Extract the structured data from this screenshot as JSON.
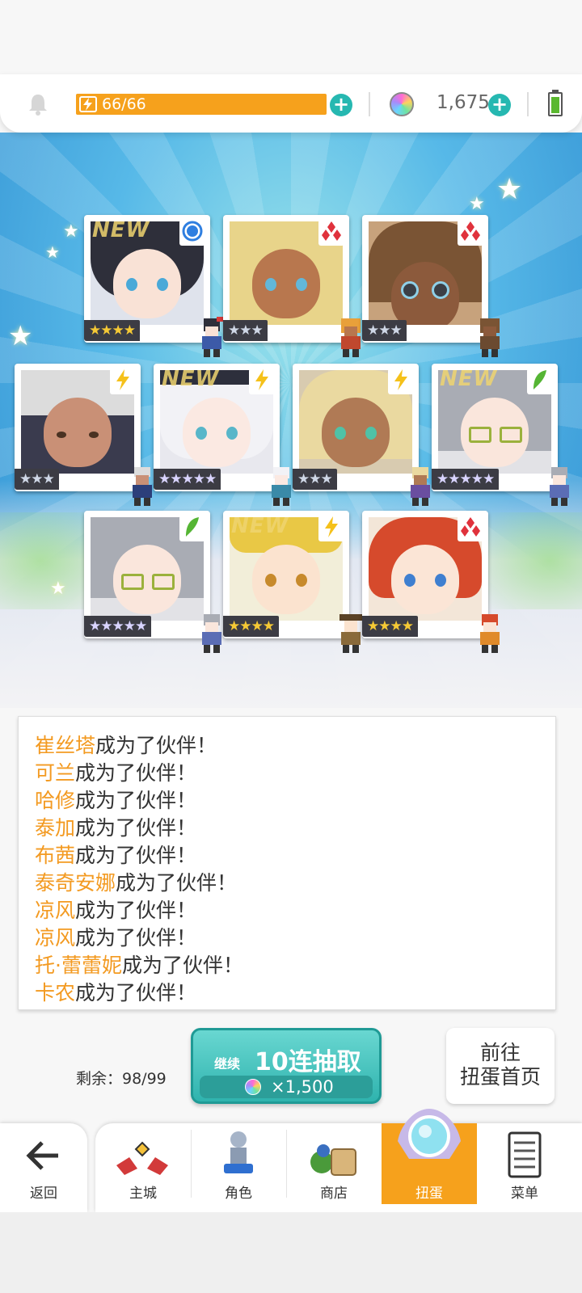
{
  "colors": {
    "accent_orange": "#f6a11c",
    "teal": "#2fb3ae",
    "name_orange": "#f39a21"
  },
  "topbar": {
    "bell_icon": "bell-icon",
    "stamina": "66/66",
    "gems": "1,675"
  },
  "results": {
    "new_label": "NEW",
    "cards": [
      {
        "stars": "★★★★",
        "attribute": "blue-circle",
        "is_new": true
      },
      {
        "stars": "★★★",
        "attribute": "red-diamond",
        "is_new": false
      },
      {
        "stars": "★★★",
        "attribute": "red-diamond",
        "is_new": false
      },
      {
        "stars": "★★★",
        "attribute": "lightning",
        "is_new": false
      },
      {
        "stars": "★★★★★",
        "attribute": "lightning",
        "is_new": true
      },
      {
        "stars": "★★★",
        "attribute": "lightning",
        "is_new": false
      },
      {
        "stars": "★★★★★",
        "attribute": "leaf",
        "is_new": true
      },
      {
        "stars": "★★★★★",
        "attribute": "leaf",
        "is_new": false
      },
      {
        "stars": "★★★★",
        "attribute": "lightning",
        "is_new": true
      },
      {
        "stars": "★★★★",
        "attribute": "red-diamond",
        "is_new": false
      }
    ]
  },
  "log": {
    "suffix": "成为了伙伴！",
    "names": [
      "崔丝塔",
      "可兰",
      "哈修",
      "泰加",
      "布茜",
      "泰奇安娜",
      "凉风",
      "凉风",
      "托·蕾蕾妮",
      "卡农"
    ]
  },
  "actions": {
    "remaining": "剩余：98/99",
    "continue_label": "继续",
    "pull_label": "10连抽取",
    "pull_cost": "×1,500",
    "home_line1": "前往",
    "home_line2": "扭蛋首页"
  },
  "nav": {
    "back": "返回",
    "tabs": [
      "主城",
      "角色",
      "商店",
      "扭蛋",
      "菜单"
    ],
    "active": "扭蛋"
  }
}
